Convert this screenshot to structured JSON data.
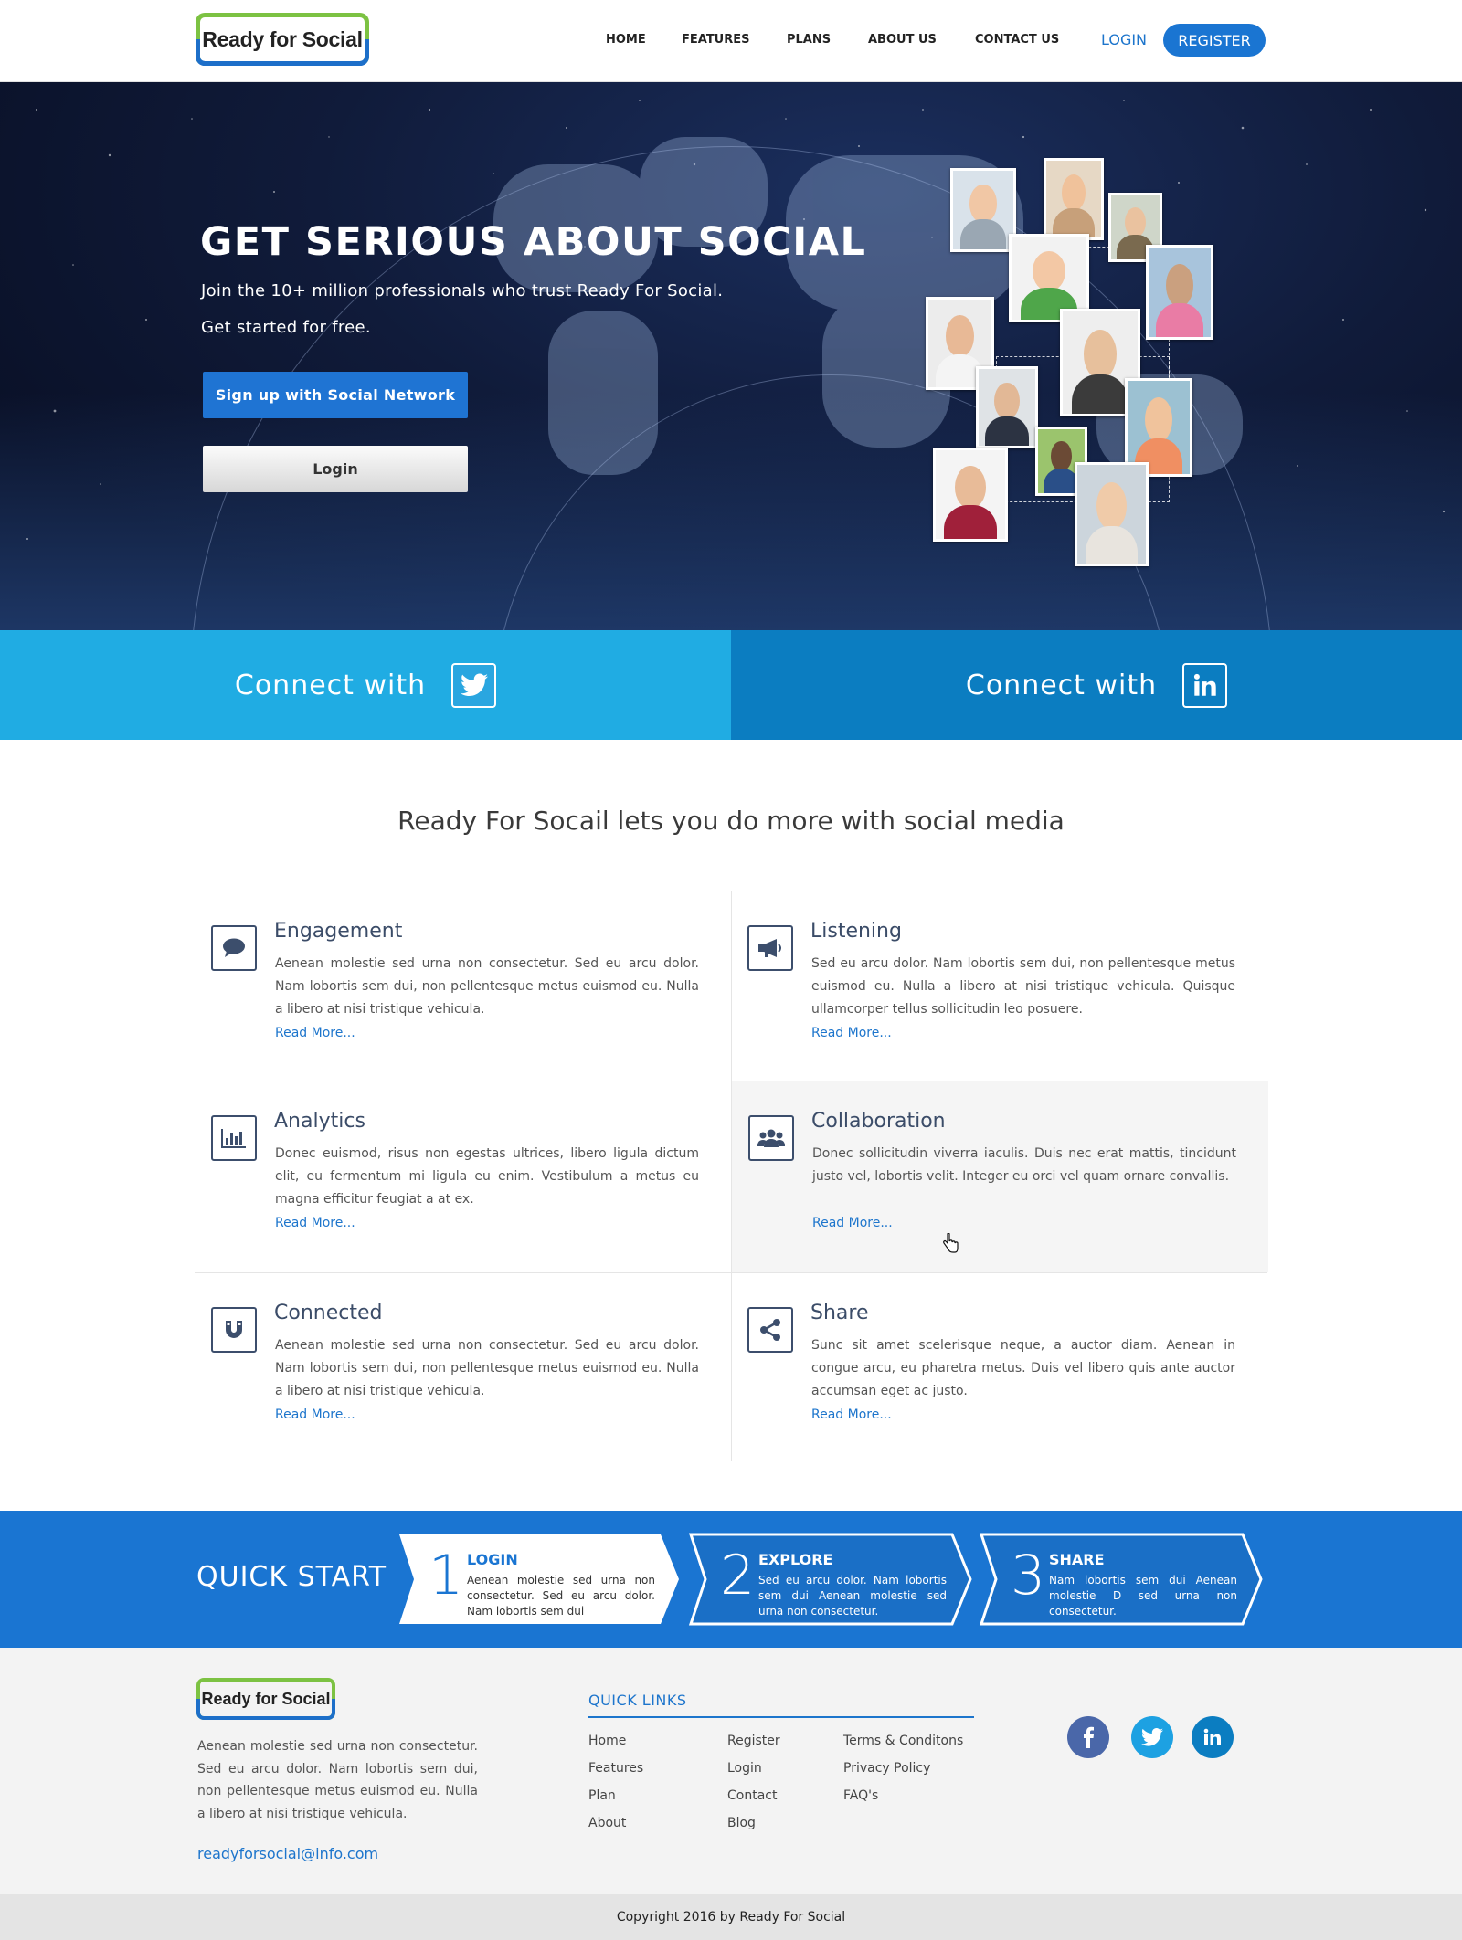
{
  "header": {
    "logo_text": "Ready for Social",
    "nav": [
      "HOME",
      "FEATURES",
      "PLANS",
      "ABOUT US",
      "CONTACT US"
    ],
    "login": "LOGIN",
    "register": "REGISTER"
  },
  "hero": {
    "title": "GET SERIOUS ABOUT SOCIAL",
    "subtitle": "Join the 10+ million professionals who trust Ready For Social.",
    "subtitle2": "Get started for free.",
    "signup_button": "Sign up with Social Network",
    "login_button": "Login"
  },
  "connect": {
    "twitter_label": "Connect with",
    "linkedin_label": "Connect with"
  },
  "features": {
    "title": "Ready For Socail lets you do more with social media",
    "read_more": "Read More...",
    "items": [
      {
        "title": "Engagement",
        "text": "Aenean molestie sed urna non consectetur. Sed eu arcu dolor. Nam lobortis sem dui, non pellentesque metus euismod eu. Nulla a libero at nisi tristique vehicula.",
        "link": "Read More...",
        "icon": "speech-bubble-icon"
      },
      {
        "title": "Listening",
        "text": "Sed eu arcu dolor. Nam lobortis sem dui, non pellentesque metus euismod eu. Nulla a libero at nisi tristique vehicula. Quisque ullamcorper tellus sollicitudin leo posuere.",
        "link": "Read More...",
        "icon": "megaphone-icon"
      },
      {
        "title": "Analytics",
        "text": "Donec euismod, risus non egestas ultrices, libero ligula dictum elit, eu fermentum mi ligula eu enim. Vestibulum a metus eu magna efficitur feugiat a at ex.",
        "link": "Read More...",
        "icon": "bar-chart-icon"
      },
      {
        "title": "Collaboration",
        "text": "Donec sollicitudin viverra iaculis. Duis nec erat mattis, tincidunt justo vel, lobortis velit. Integer eu orci vel quam ornare convallis.",
        "link": "Read More...",
        "icon": "users-icon"
      },
      {
        "title": "Connected",
        "text": "Aenean molestie sed urna non consectetur. Sed eu arcu dolor. Nam lobortis sem dui, non pellentesque metus euismod eu. Nulla a libero at nisi tristique vehicula.",
        "link": "Read More...",
        "icon": "magnet-icon"
      },
      {
        "title": "Share",
        "text": "Sunc sit amet scelerisque neque, a auctor diam. Aenean in congue arcu, eu pharetra metus. Duis vel libero quis ante auctor accumsan eget ac justo.",
        "link": "Read More...",
        "icon": "share-icon"
      }
    ]
  },
  "quick_start": {
    "title": "QUICK START",
    "steps": [
      {
        "num": "1",
        "title": "LOGIN",
        "text": "Aenean molestie sed urna non consectetur. Sed eu arcu dolor. Nam lobortis sem dui"
      },
      {
        "num": "2",
        "title": "EXPLORE",
        "text": "Sed eu arcu dolor. Nam lobortis sem dui Aenean molestie sed urna non consectetur."
      },
      {
        "num": "3",
        "title": "SHARE",
        "text": "Nam lobortis sem dui Aenean molestie D sed urna non consectetur."
      }
    ]
  },
  "footer": {
    "logo_text": "Ready for Social",
    "description": "Aenean molestie sed urna non consectetur. Sed eu arcu dolor. Nam lobortis sem dui, non pellentesque metus euismod eu. Nulla a libero at nisi tristique vehicula.",
    "email": "readyforsocial@info.com",
    "quick_links_title": "QUICK LINKS",
    "links_col1": [
      "Home",
      "Features",
      "Plan",
      "About"
    ],
    "links_col2": [
      "Register",
      "Login",
      "Contact",
      "Blog"
    ],
    "links_col3": [
      "Terms & Conditons",
      "Privacy Policy",
      "FAQ's"
    ],
    "copyright": "Copyright 2016 by Ready For Social"
  },
  "colors": {
    "brand_blue": "#1a75d2",
    "brand_green": "#7cc242",
    "twitter": "#20ace3",
    "linkedin": "#0b7dc1",
    "facebook": "#4a67a9"
  }
}
